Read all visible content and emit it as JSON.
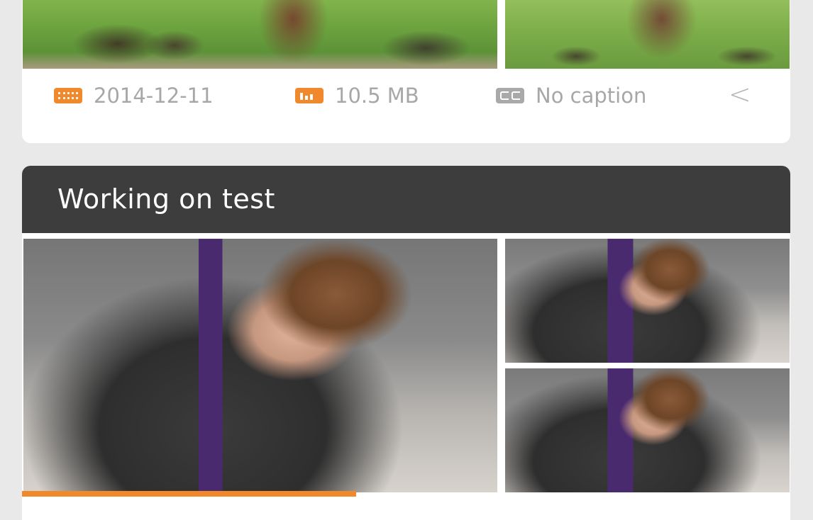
{
  "top_card": {
    "date": "2014-12-11",
    "size": "10.5 MB",
    "caption": "No caption",
    "icons": {
      "date": "calendar-icon",
      "size": "file-size-icon",
      "caption": "caption-icon",
      "back": "chevron-left-icon"
    },
    "chevron_glyph": "<"
  },
  "album_card": {
    "title": "Working on test"
  },
  "progress": {
    "fraction": 0.435
  },
  "colors": {
    "accent": "#f0892c",
    "header_bg": "#3d3d3d",
    "background": "#e9e9e9",
    "muted_text": "#a7a7a7"
  }
}
